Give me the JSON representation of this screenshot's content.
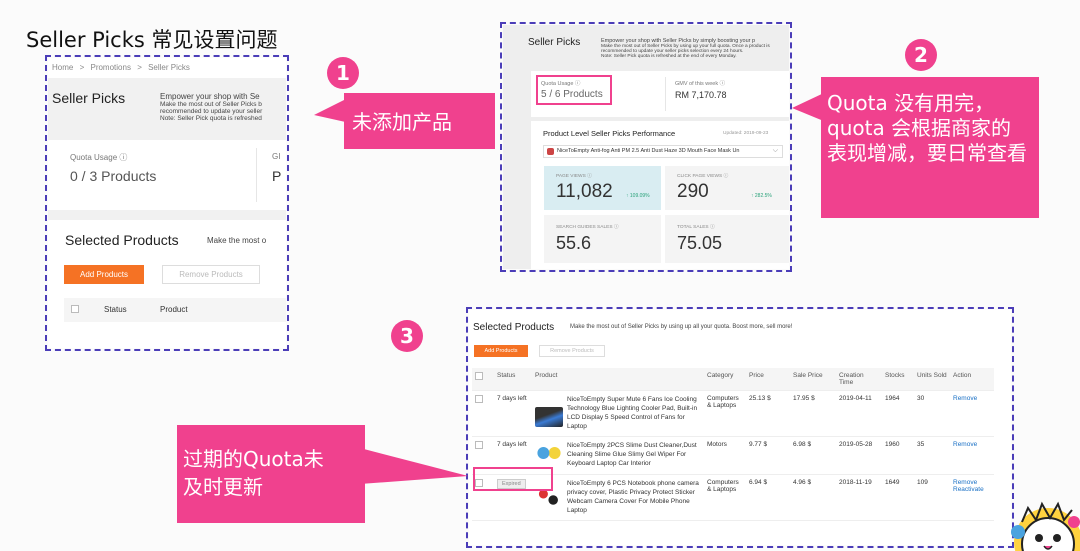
{
  "title": "Seller Picks 常见设置问题",
  "shot1": {
    "breadcrumb": [
      "Home",
      ">",
      "Promotions",
      ">",
      "Seller Picks"
    ],
    "heading": "Seller Picks",
    "desc_1": "Empower your shop with Se",
    "desc_2": "Make the most out of Seller Picks b",
    "desc_3": "recommended to update your seller",
    "desc_4": "Note: Seller Pick quota is refreshed",
    "quota_label": "Quota Usage ⓘ",
    "quota_value": "0 / 3 Products",
    "gmv_label": "GI",
    "gmv_value": "P",
    "selected_title": "Selected Products",
    "selected_desc": "Make the most o",
    "add_btn": "Add Products",
    "remove_btn": "Remove Products",
    "col_status": "Status",
    "col_product": "Product"
  },
  "callout1": "未添加产品",
  "shot2": {
    "heading": "Seller Picks",
    "desc_1": "Empower your shop with Seller Picks by simply boosting your p",
    "desc_2": "Make the most out of Seller Picks by using up your full quota. Once a product is",
    "desc_3": "recommended to update your seller picks selection every 24 hours.",
    "desc_4": "Note: Seller Pick quota is refreshed at the end of every Monday.",
    "quota_label": "Quota Usage ⓘ",
    "quota_value": "5 / 6 Products",
    "gmv_label": "GMV of this week ⓘ",
    "gmv_value": "RM 7,170.78",
    "perf_title": "Product Level Seller Picks Performance",
    "updated": "Updated: 2019-09-23",
    "product_select": "NiceToEmpty Anti-fog Anti PM 2.5 Anti Dust Haze 3D Mouth Face Mask Un",
    "metrics": [
      {
        "label": "PAGE VIEWS ⓘ",
        "value": "11,082",
        "delta": "↑ 109.09%"
      },
      {
        "label": "CLICK PAGE VIEWS ⓘ",
        "value": "290",
        "delta": "↑ 282.5%"
      },
      {
        "label": "SEARCH GUIDES SALES ⓘ",
        "value": "55.6",
        "delta": ""
      },
      {
        "label": "TOTAL SALES ⓘ",
        "value": "75.05",
        "delta": ""
      }
    ]
  },
  "callout2": "Quota 没有用完，quota 会根据商家的表现增减，要日常查看",
  "shot3": {
    "selected_title": "Selected Products",
    "selected_desc": "Make the most out of Seller Picks by using up all your quota. Boost more, sell more!",
    "add_btn": "Add Products",
    "remove_btn": "Remove Products",
    "headers": [
      "Status",
      "Product",
      "Category",
      "Price",
      "Sale Price",
      "Creation Time",
      "Stocks",
      "Units Sold",
      "Action"
    ],
    "rows": [
      {
        "status": "7 days left",
        "product": "NiceToEmpty Super Mute 6 Fans Ice Cooling Technology Blue Lighting Cooler Pad, Built-in LCD Display 5 Speed Control of Fans for Laptop",
        "category": "Computers & Laptops",
        "price": "25.13 $",
        "sale": "17.95 $",
        "created": "2019-04-11",
        "stocks": "1964",
        "sold": "30",
        "action": "Remove",
        "action2": ""
      },
      {
        "status": "7 days left",
        "product": "NiceToEmpty 2PCS Slime Dust Cleaner,Dust Cleaning Slime Glue Slimy Gel Wiper For Keyboard Laptop Car Interior",
        "category": "Motors",
        "price": "9.77 $",
        "sale": "6.98 $",
        "created": "2019-05-28",
        "stocks": "1960",
        "sold": "35",
        "action": "Remove",
        "action2": ""
      },
      {
        "status": "Expired",
        "product": "NiceToEmpty 6 PCS Notebook phone camera privacy cover, Plastic Privacy Protect Sticker Webcam Camera Cover For Mobile Phone Laptop",
        "category": "Computers & Laptops",
        "price": "6.94 $",
        "sale": "4.96 $",
        "created": "2018-11-19",
        "stocks": "1649",
        "sold": "109",
        "action": "Remove",
        "action2": "Reactivate"
      }
    ]
  },
  "callout3": "过期的Quota未及时更新",
  "colors": {
    "accent": "#f0418e",
    "border": "#4b3db8",
    "orange": "#f57224"
  }
}
